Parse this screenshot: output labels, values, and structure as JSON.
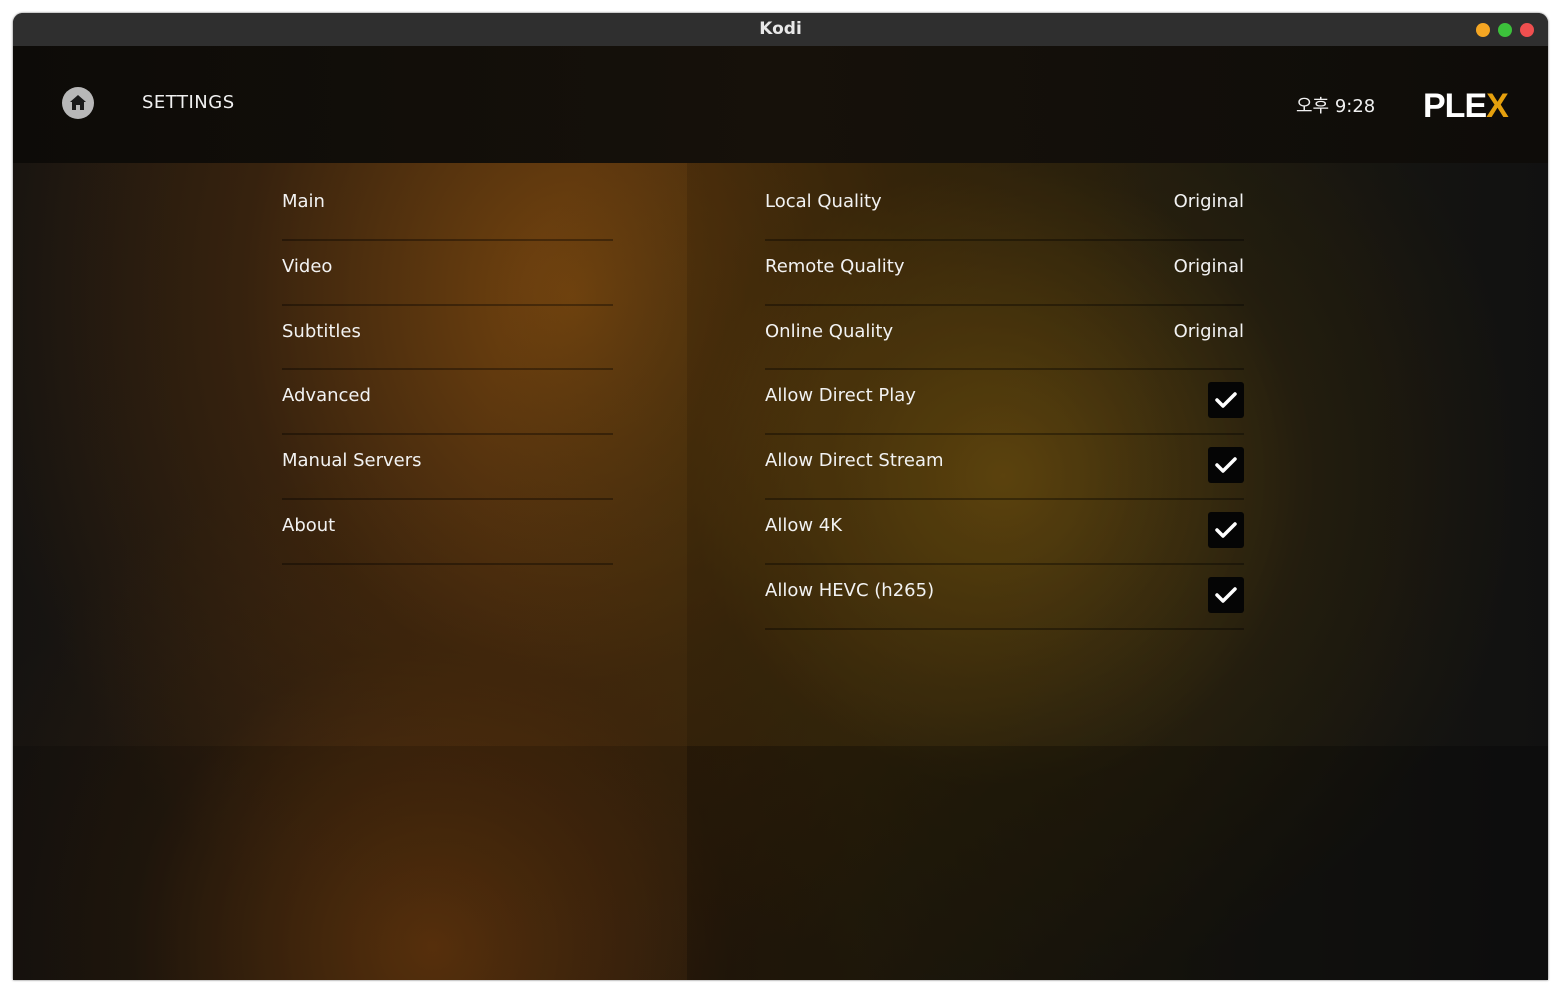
{
  "window": {
    "title": "Kodi",
    "controls": {
      "minimize": "#f5a623",
      "maximize": "#3cc13b",
      "close": "#ef4f4f"
    }
  },
  "header": {
    "home_icon": "home-icon",
    "title": "SETTINGS",
    "clock": "오후 9:28",
    "logo_main": "PLE",
    "logo_accent": "X",
    "logo_accent_color": "#e5a00d"
  },
  "nav": {
    "items": [
      {
        "label": "Main"
      },
      {
        "label": "Video"
      },
      {
        "label": "Subtitles"
      },
      {
        "label": "Advanced"
      },
      {
        "label": "Manual Servers"
      },
      {
        "label": "About"
      }
    ]
  },
  "settings": {
    "rows": [
      {
        "label": "Local Quality",
        "value": "Original"
      },
      {
        "label": "Remote Quality",
        "value": "Original"
      },
      {
        "label": "Online Quality",
        "value": "Original"
      },
      {
        "label": "Allow Direct Play",
        "checked": true
      },
      {
        "label": "Allow Direct Stream",
        "checked": true
      },
      {
        "label": "Allow 4K",
        "checked": true
      },
      {
        "label": "Allow HEVC (h265)",
        "checked": true
      }
    ]
  }
}
